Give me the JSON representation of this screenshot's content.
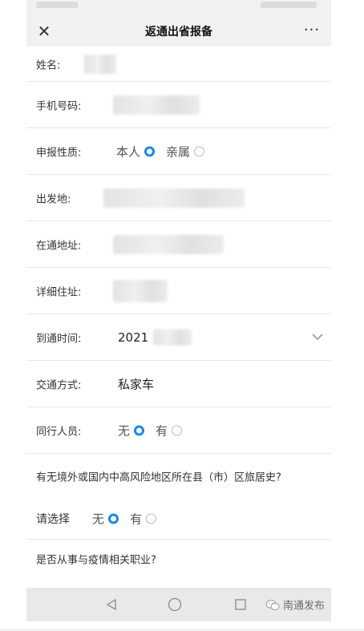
{
  "header": {
    "close_icon": "✕",
    "title": "返通出省报备",
    "more_icon": "···"
  },
  "form": {
    "name_label": "姓名:",
    "phone_label": "手机号码:",
    "report_type": {
      "label": "申报性质:",
      "options": [
        "本人",
        "亲属"
      ],
      "selected": "本人"
    },
    "origin_label": "出发地:",
    "address_label": "在通地址:",
    "detail_label": "详细住址:",
    "arrival": {
      "label": "到通时间:",
      "value": "2021"
    },
    "transport": {
      "label": "交通方式:",
      "value": "私家车"
    },
    "companions": {
      "label": "同行人员:",
      "options": [
        "无",
        "有"
      ],
      "selected": "无"
    },
    "travel_history": {
      "question": "有无境外或国内中高风险地区所在县（市）区旅居史?",
      "label": "请选择",
      "options": [
        "无",
        "有"
      ],
      "selected": "无"
    },
    "occupation_question": "是否从事与疫情相关职业?"
  },
  "navbar": {
    "watermark": "南通发布"
  },
  "colors": {
    "accent": "#1a88e6",
    "bar_bg": "#f1f1f1"
  }
}
